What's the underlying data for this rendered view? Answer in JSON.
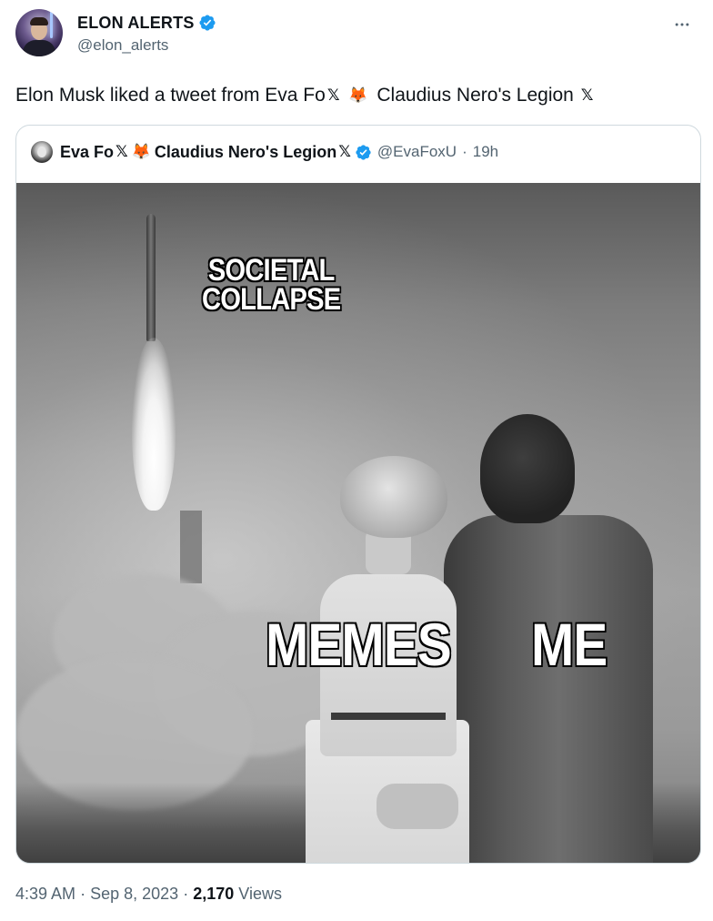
{
  "author": {
    "display_name": "ELON ALERTS",
    "handle": "@elon_alerts",
    "verified": true
  },
  "more_icon": "more-dots-icon",
  "tweet": {
    "text_prefix": "Elon Musk liked a tweet from Eva Fo",
    "text_x1": "𝕏",
    "text_fox": "🦊",
    "text_suffix": "Claudius Nero's Legion",
    "text_x2": "𝕏"
  },
  "quoted": {
    "name_part1": "Eva Fo",
    "name_x1": "𝕏",
    "name_fox": "🦊",
    "name_part2": "Claudius Nero's Legion",
    "name_x2": "𝕏",
    "verified": true,
    "handle": "@EvaFoxU",
    "separator": "·",
    "time": "19h",
    "image": {
      "caption_top_line1": "SOCIETAL",
      "caption_top_line2": "COLLAPSE",
      "caption_left": "MEMES",
      "caption_right": "ME"
    }
  },
  "footer": {
    "time": "4:39 AM",
    "sep1": "·",
    "date": "Sep 8, 2023",
    "sep2": "·",
    "views_count": "2,170",
    "views_label": "Views"
  },
  "colors": {
    "verified_blue": "#1d9bf0",
    "secondary_text": "#536471",
    "primary_text": "#0f1419",
    "border": "#cfd9de"
  }
}
